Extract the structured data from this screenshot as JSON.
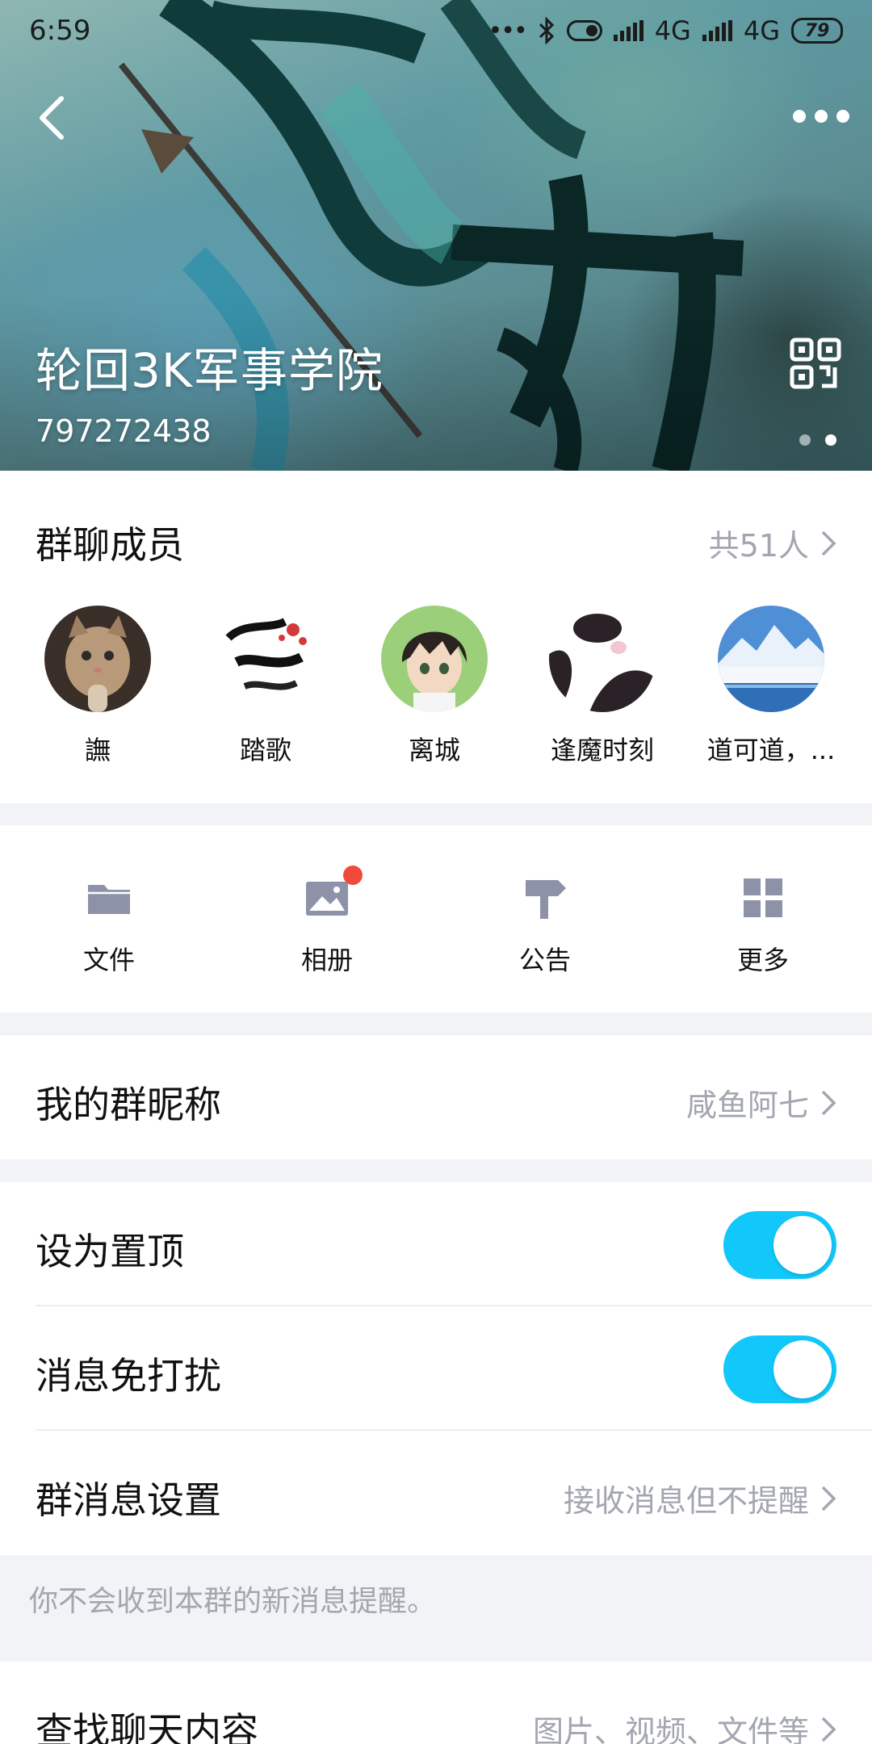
{
  "status_bar": {
    "time": "6:59",
    "network_1": "4G",
    "network_2": "4G",
    "battery": "79"
  },
  "header": {
    "group_name": "轮回3K军事学院",
    "group_id": "797272438"
  },
  "members": {
    "title": "群聊成员",
    "count": "共51人",
    "list": [
      {
        "name": "譕"
      },
      {
        "name": "踏歌"
      },
      {
        "name": "离城"
      },
      {
        "name": "逢魔时刻"
      },
      {
        "name": "道可道，..."
      }
    ]
  },
  "actions": [
    {
      "label": "文件",
      "icon": "folder-icon"
    },
    {
      "label": "相册",
      "icon": "album-icon"
    },
    {
      "label": "公告",
      "icon": "signpost-icon"
    },
    {
      "label": "更多",
      "icon": "grid-icon"
    }
  ],
  "nickname": {
    "label": "我的群昵称",
    "value": "咸鱼阿七"
  },
  "settings": {
    "pin": {
      "label": "设为置顶",
      "on": true
    },
    "mute": {
      "label": "消息免打扰",
      "on": true
    },
    "notify": {
      "label": "群消息设置",
      "value": "接收消息但不提醒"
    }
  },
  "hint": "你不会收到本群的新消息提醒。",
  "search": {
    "label": "查找聊天内容",
    "value": "图片、视频、文件等"
  },
  "colors": {
    "switch_on": "#12c7f9",
    "badge": "#f04a3a",
    "secondary_text": "#a3a6b0",
    "action_icon": "#8d92a8"
  }
}
